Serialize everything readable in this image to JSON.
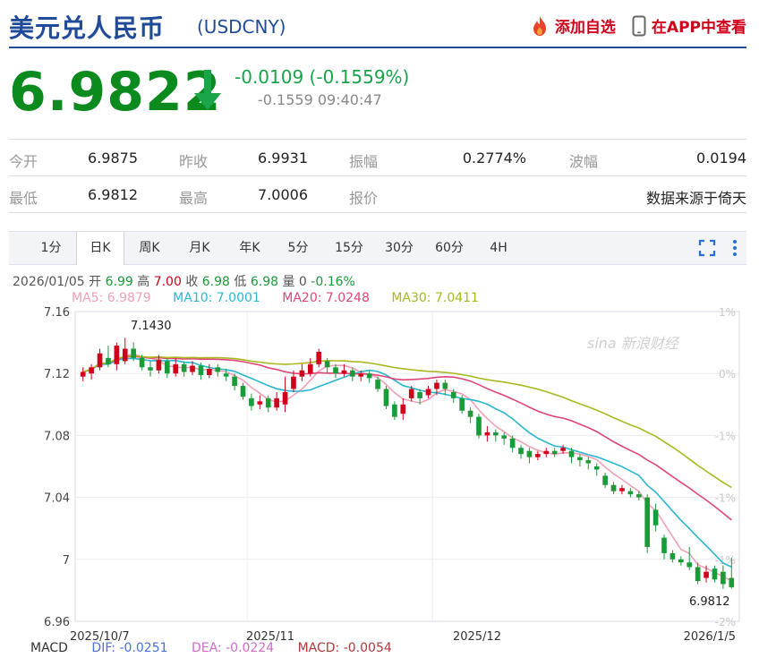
{
  "header": {
    "title": "美元兑人民币",
    "code": "(USDCNY)",
    "add_watchlist": "添加自选",
    "view_app": "在APP中查看"
  },
  "quote": {
    "price": "6.9822",
    "direction": "down",
    "change": "-0.0109 (-0.1559%)",
    "sub_change": "-0.1559",
    "time": "09:40:47"
  },
  "stats": {
    "row1": [
      {
        "label": "今开",
        "value": "6.9875"
      },
      {
        "label": "昨收",
        "value": "6.9931"
      },
      {
        "label": "振幅",
        "value": "0.2774%"
      },
      {
        "label": "波幅",
        "value": "0.0194"
      }
    ],
    "row2": [
      {
        "label": "最低",
        "value": "6.9812"
      },
      {
        "label": "最高",
        "value": "7.0006"
      },
      {
        "label": "报价",
        "value": ""
      },
      {
        "label": "",
        "value": "数据来源于倚天"
      }
    ]
  },
  "tabs": [
    "1分",
    "日K",
    "周K",
    "月K",
    "年K",
    "5分",
    "15分",
    "30分",
    "60分",
    "4H"
  ],
  "active_tab": "日K",
  "info_row": {
    "date": "2026/01/05",
    "open_label": "开",
    "open": "6.99",
    "high_label": "高",
    "high": "7.00",
    "close_label": "收",
    "close": "6.98",
    "low_label": "低",
    "low": "6.98",
    "volume_label": "量",
    "volume": "0",
    "change": "-0.16%"
  },
  "ma_legend": [
    {
      "label": "MA5: 6.9879",
      "color": "#f2a0b5"
    },
    {
      "label": "MA10: 7.0001",
      "color": "#2ab6d0"
    },
    {
      "label": "MA20: 7.0248",
      "color": "#e0457a"
    },
    {
      "label": "MA30: 7.0411",
      "color": "#a8b81e"
    }
  ],
  "macd_legend": [
    {
      "label": "MACD",
      "color": "#333333"
    },
    {
      "label": "DIF: -0.0251",
      "color": "#4a6fd6"
    },
    {
      "label": "DEA: -0.0224",
      "color": "#d66ac8"
    },
    {
      "label": "MACD: -0.0054",
      "color": "#b03a3a"
    }
  ],
  "watermark": "sina 新浪财经",
  "colors": {
    "brand": "#1f4b99",
    "down": "#1a9b3a",
    "up": "#d0021b"
  },
  "chart_data": {
    "type": "candlestick",
    "y_ticks": [
      "7.16",
      "7.12",
      "7.08",
      "7.04",
      "7",
      "6.96"
    ],
    "y_range": [
      6.96,
      7.16
    ],
    "pct_ticks": [
      "1%",
      "0%",
      "-1%",
      "-1%",
      "-1%",
      "-2%"
    ],
    "x_ticks": [
      "2025/10/7",
      "2025/11",
      "2025/12",
      "2026/1/5"
    ],
    "max_label": "7.1430",
    "min_label": "6.9812",
    "candles": [
      [
        7.118,
        7.121,
        7.115,
        7.124
      ],
      [
        7.12,
        7.124,
        7.116,
        7.126
      ],
      [
        7.124,
        7.133,
        7.122,
        7.136
      ],
      [
        7.13,
        7.126,
        7.124,
        7.138
      ],
      [
        7.126,
        7.138,
        7.122,
        7.14
      ],
      [
        7.128,
        7.136,
        7.126,
        7.143
      ],
      [
        7.136,
        7.13,
        7.128,
        7.14
      ],
      [
        7.13,
        7.124,
        7.122,
        7.132
      ],
      [
        7.124,
        7.122,
        7.118,
        7.128
      ],
      [
        7.122,
        7.129,
        7.12,
        7.132
      ],
      [
        7.128,
        7.12,
        7.117,
        7.13
      ],
      [
        7.12,
        7.126,
        7.118,
        7.13
      ],
      [
        7.126,
        7.121,
        7.118,
        7.128
      ],
      [
        7.121,
        7.125,
        7.119,
        7.128
      ],
      [
        7.125,
        7.119,
        7.116,
        7.127
      ],
      [
        7.119,
        7.123,
        7.117,
        7.126
      ],
      [
        7.124,
        7.121,
        7.118,
        7.126
      ],
      [
        7.12,
        7.118,
        7.115,
        7.123
      ],
      [
        7.118,
        7.112,
        7.109,
        7.12
      ],
      [
        7.112,
        7.105,
        7.103,
        7.114
      ],
      [
        7.104,
        7.099,
        7.096,
        7.107
      ],
      [
        7.1,
        7.102,
        7.097,
        7.106
      ],
      [
        7.104,
        7.098,
        7.095,
        7.106
      ],
      [
        7.098,
        7.104,
        7.096,
        7.108
      ],
      [
        7.1,
        7.108,
        7.095,
        7.118
      ],
      [
        7.11,
        7.118,
        7.108,
        7.122
      ],
      [
        7.118,
        7.122,
        7.115,
        7.126
      ],
      [
        7.12,
        7.126,
        7.118,
        7.13
      ],
      [
        7.126,
        7.134,
        7.124,
        7.136
      ],
      [
        7.128,
        7.124,
        7.12,
        7.13
      ],
      [
        7.124,
        7.12,
        7.117,
        7.126
      ],
      [
        7.12,
        7.122,
        7.118,
        7.126
      ],
      [
        7.122,
        7.118,
        7.115,
        7.124
      ],
      [
        7.118,
        7.12,
        7.115,
        7.122
      ],
      [
        7.12,
        7.117,
        7.114,
        7.122
      ],
      [
        7.116,
        7.11,
        7.108,
        7.118
      ],
      [
        7.11,
        7.099,
        7.097,
        7.112
      ],
      [
        7.1,
        7.092,
        7.09,
        7.102
      ],
      [
        7.094,
        7.1,
        7.09,
        7.104
      ],
      [
        7.104,
        7.11,
        7.102,
        7.112
      ],
      [
        7.108,
        7.104,
        7.1,
        7.11
      ],
      [
        7.106,
        7.11,
        7.104,
        7.112
      ],
      [
        7.11,
        7.114,
        7.106,
        7.116
      ],
      [
        7.114,
        7.11,
        7.106,
        7.116
      ],
      [
        7.108,
        7.104,
        7.101,
        7.11
      ],
      [
        7.104,
        7.096,
        7.094,
        7.106
      ],
      [
        7.096,
        7.092,
        7.088,
        7.098
      ],
      [
        7.092,
        7.08,
        7.078,
        7.094
      ],
      [
        7.08,
        7.082,
        7.076,
        7.086
      ],
      [
        7.082,
        7.08,
        7.076,
        7.084
      ],
      [
        7.08,
        7.078,
        7.074,
        7.082
      ],
      [
        7.078,
        7.072,
        7.069,
        7.08
      ],
      [
        7.072,
        7.068,
        7.065,
        7.074
      ],
      [
        7.07,
        7.066,
        7.062,
        7.072
      ],
      [
        7.066,
        7.068,
        7.064,
        7.07
      ],
      [
        7.068,
        7.07,
        7.066,
        7.072
      ],
      [
        7.07,
        7.068,
        7.066,
        7.072
      ],
      [
        7.07,
        7.072,
        7.068,
        7.074
      ],
      [
        7.07,
        7.066,
        7.062,
        7.072
      ],
      [
        7.066,
        7.064,
        7.06,
        7.068
      ],
      [
        7.064,
        7.062,
        7.058,
        7.066
      ],
      [
        7.06,
        7.058,
        7.054,
        7.062
      ],
      [
        7.054,
        7.048,
        7.046,
        7.056
      ],
      [
        7.048,
        7.044,
        7.042,
        7.05
      ],
      [
        7.044,
        7.046,
        7.042,
        7.048
      ],
      [
        7.044,
        7.042,
        7.04,
        7.046
      ],
      [
        7.042,
        7.04,
        7.038,
        7.044
      ],
      [
        7.04,
        7.008,
        7.004,
        7.042
      ],
      [
        7.032,
        7.022,
        7.018,
        7.036
      ],
      [
        7.014,
        7.004,
        7.0,
        7.016
      ],
      [
        7.004,
        7.0,
        6.998,
        7.006
      ],
      [
        7.0,
        6.998,
        6.996,
        7.002
      ],
      [
        6.998,
        6.995,
        6.993,
        7.008
      ],
      [
        6.995,
        6.986,
        6.984,
        6.998
      ],
      [
        6.988,
        6.992,
        6.985,
        6.996
      ],
      [
        6.994,
        6.987,
        6.985,
        6.996
      ],
      [
        6.992,
        6.984,
        6.981,
        6.996
      ],
      [
        6.988,
        6.982,
        6.981,
        7.001
      ]
    ],
    "ma5_color": "#f2a0b5",
    "ma10_color": "#2ab6d0",
    "ma20_color": "#e0457a",
    "ma30_color": "#a8b81e",
    "grid": true
  }
}
